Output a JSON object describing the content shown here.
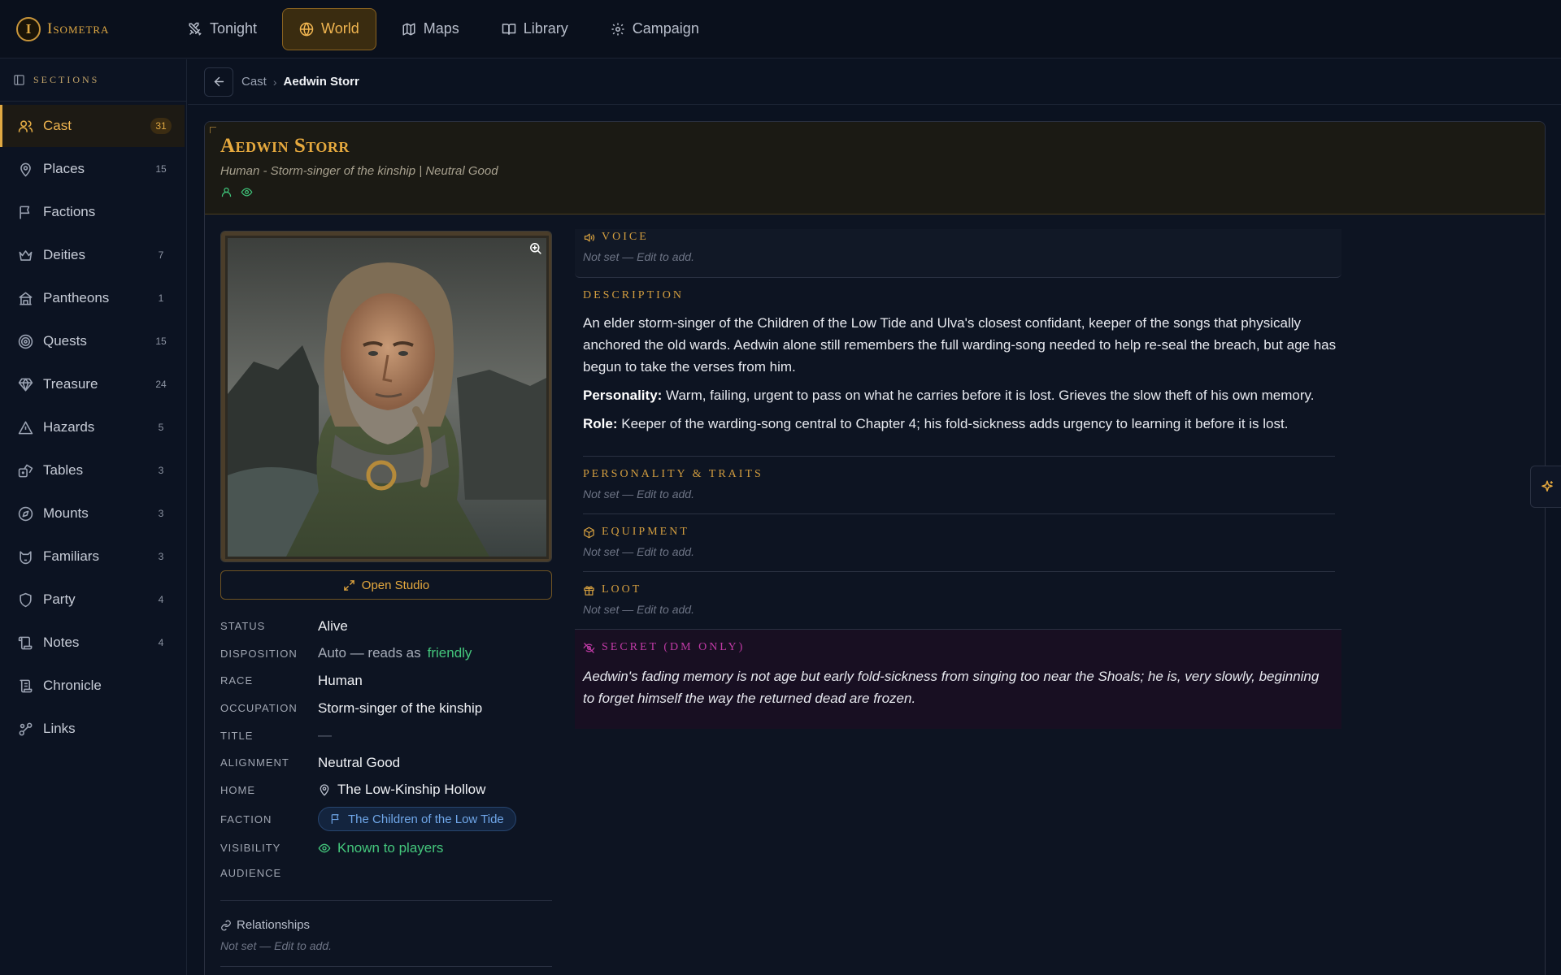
{
  "app": {
    "logo_letter": "I",
    "name": "Isometra"
  },
  "nav": [
    {
      "label": "Tonight",
      "icon": "swords-icon"
    },
    {
      "label": "World",
      "icon": "globe-icon",
      "active": true
    },
    {
      "label": "Maps",
      "icon": "map-icon"
    },
    {
      "label": "Library",
      "icon": "book-icon"
    },
    {
      "label": "Campaign",
      "icon": "gear-icon"
    }
  ],
  "sidebar": {
    "title": "SECTIONS",
    "items": [
      {
        "label": "Cast",
        "count": "31",
        "active": true
      },
      {
        "label": "Places",
        "count": "15"
      },
      {
        "label": "Factions",
        "count": ""
      },
      {
        "label": "Deities",
        "count": "7"
      },
      {
        "label": "Pantheons",
        "count": "1"
      },
      {
        "label": "Quests",
        "count": "15"
      },
      {
        "label": "Treasure",
        "count": "24"
      },
      {
        "label": "Hazards",
        "count": "5"
      },
      {
        "label": "Tables",
        "count": "3"
      },
      {
        "label": "Mounts",
        "count": "3"
      },
      {
        "label": "Familiars",
        "count": "3"
      },
      {
        "label": "Party",
        "count": "4"
      },
      {
        "label": "Notes",
        "count": "4"
      },
      {
        "label": "Chronicle",
        "count": ""
      },
      {
        "label": "Links",
        "count": ""
      }
    ]
  },
  "breadcrumb": {
    "parent": "Cast",
    "separator": "›",
    "current": "Aedwin Storr"
  },
  "character": {
    "name": "Aedwin Storr",
    "subtitle": "Human - Storm-singer of the kinship | Neutral Good",
    "open_studio_label": "Open Studio",
    "fields": {
      "status_label": "STATUS",
      "status": "Alive",
      "disposition_label": "DISPOSITION",
      "disposition_prefix": "Auto — reads as",
      "disposition_value": "friendly",
      "race_label": "RACE",
      "race": "Human",
      "occupation_label": "OCCUPATION",
      "occupation": "Storm-singer of the kinship",
      "title_label": "TITLE",
      "title": "—",
      "alignment_label": "ALIGNMENT",
      "alignment": "Neutral Good",
      "home_label": "HOME",
      "home": "The Low-Kinship Hollow",
      "faction_label": "FACTION",
      "faction": "The Children of the Low Tide",
      "visibility_label": "VISIBILITY",
      "visibility": "Known to players",
      "audience_label": "AUDIENCE"
    },
    "relationships_title": "Relationships",
    "relationships_empty": "Not set — Edit to add."
  },
  "sections": {
    "voice_title": "VOICE",
    "voice_empty": "Not set — Edit to add.",
    "description_title": "DESCRIPTION",
    "description": "An elder storm-singer of the Children of the Low Tide and Ulva's closest confidant, keeper of the songs that physically anchored the old wards. Aedwin alone still remembers the full warding-song needed to help re-seal the breach, but age has begun to take the verses from him.",
    "personality_label": "Personality:",
    "personality": "Warm, failing, urgent to pass on what he carries before it is lost. Grieves the slow theft of his own memory.",
    "role_label": "Role:",
    "role": "Keeper of the warding-song central to Chapter 4; his fold-sickness adds urgency to learning it before it is lost.",
    "traits_title": "PERSONALITY & TRAITS",
    "traits_empty": "Not set — Edit to add.",
    "equipment_title": "EQUIPMENT",
    "equipment_empty": "Not set — Edit to add.",
    "loot_title": "LOOT",
    "loot_empty": "Not set — Edit to add.",
    "secret_title": "SECRET (DM ONLY)",
    "secret": "Aedwin's fading memory is not age but early fold-sickness from singing too near the Shoals; he is, very slowly, beginning to forget himself the way the returned dead are frozen."
  },
  "colors": {
    "accent": "#e0a943",
    "friendly": "#44c77c",
    "faction": "#6fa6e8",
    "secret": "#c13aa6"
  }
}
